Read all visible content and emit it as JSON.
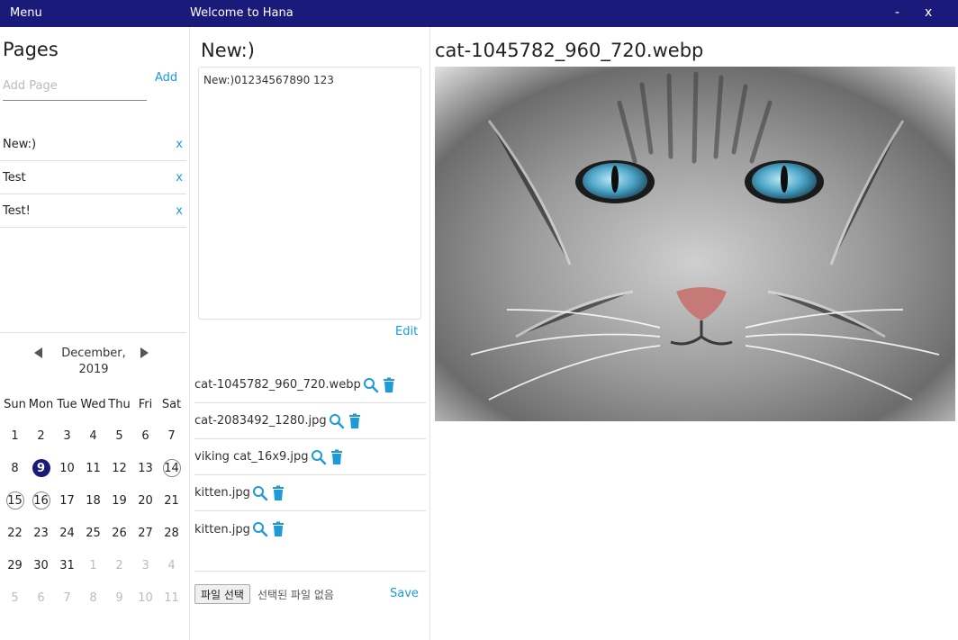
{
  "titlebar": {
    "menu": "Menu",
    "title": "Welcome to Hana",
    "minimize": "-",
    "close": "x"
  },
  "pages": {
    "heading": "Pages",
    "add_placeholder": "Add Page",
    "add_label": "Add",
    "items": [
      {
        "label": "New:)",
        "delete": "x"
      },
      {
        "label": "Test",
        "delete": "x"
      },
      {
        "label": "Test!",
        "delete": "x"
      }
    ]
  },
  "calendar": {
    "month_line1": "December,",
    "month_line2": "2019",
    "weekdays": [
      "Sun",
      "Mon",
      "Tue",
      "Wed",
      "Thu",
      "Fri",
      "Sat"
    ],
    "weeks": [
      [
        "1",
        "2",
        "3",
        "4",
        "5",
        "6",
        "7"
      ],
      [
        "8",
        "9",
        "10",
        "11",
        "12",
        "13",
        "14"
      ],
      [
        "15",
        "16",
        "17",
        "18",
        "19",
        "20",
        "21"
      ],
      [
        "22",
        "23",
        "24",
        "25",
        "26",
        "27",
        "28"
      ],
      [
        "29",
        "30",
        "31",
        "1",
        "2",
        "3",
        "4"
      ],
      [
        "5",
        "6",
        "7",
        "8",
        "9",
        "10",
        "11"
      ]
    ],
    "selected_day": "9",
    "marked_days": [
      "14",
      "15",
      "16"
    ]
  },
  "note": {
    "title": "New:)",
    "content": "New:)01234567890 123",
    "edit_label": "Edit"
  },
  "files": {
    "items": [
      {
        "name": "cat-1045782_960_720.webp"
      },
      {
        "name": "cat-2083492_1280.jpg"
      },
      {
        "name": "viking cat_16x9.jpg"
      },
      {
        "name": "kitten.jpg"
      },
      {
        "name": "kitten.jpg"
      }
    ],
    "choose_label": "파일 선택",
    "no_file_label": "선택된 파일 없음",
    "save_label": "Save"
  },
  "viewer": {
    "title": "cat-1045782_960_720.webp"
  },
  "colors": {
    "titlebar": "#1a1a7a",
    "accent": "#1e9ad6",
    "today": "#1a1a7a"
  }
}
